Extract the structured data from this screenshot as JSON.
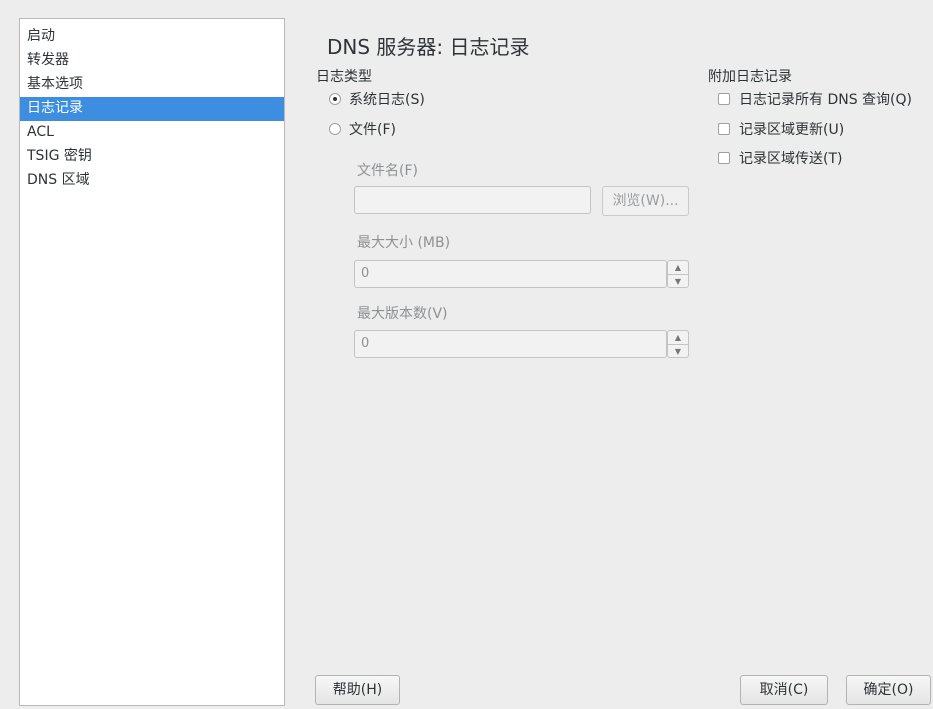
{
  "sidebar": {
    "items": [
      {
        "label": "启动",
        "selected": false
      },
      {
        "label": "转发器",
        "selected": false
      },
      {
        "label": "基本选项",
        "selected": false
      },
      {
        "label": "日志记录",
        "selected": true
      },
      {
        "label": "ACL",
        "selected": false
      },
      {
        "label": "TSIG 密钥",
        "selected": false
      },
      {
        "label": "DNS 区域",
        "selected": false
      }
    ]
  },
  "page": {
    "title": "DNS 服务器: 日志记录"
  },
  "log_type": {
    "label": "日志类型",
    "syslog_label": "系统日志(S)",
    "file_label": "文件(F)",
    "selected": "syslog"
  },
  "file": {
    "filename_label": "文件名(F)",
    "filename_value": "",
    "browse_label": "浏览(W)...",
    "max_size_label": "最大大小 (MB)",
    "max_size_value": "0",
    "max_versions_label": "最大版本数(V)",
    "max_versions_value": "0"
  },
  "extra_logging": {
    "label": "附加日志记录",
    "options": [
      {
        "label": "日志记录所有 DNS 查询(Q)",
        "checked": false
      },
      {
        "label": "记录区域更新(U)",
        "checked": false
      },
      {
        "label": "记录区域传送(T)",
        "checked": false
      }
    ]
  },
  "footer": {
    "help_label": "帮助(H)",
    "cancel_label": "取消(C)",
    "ok_label": "确定(O)"
  },
  "colors": {
    "selection": "#3d8ee0",
    "background": "#ededed"
  }
}
